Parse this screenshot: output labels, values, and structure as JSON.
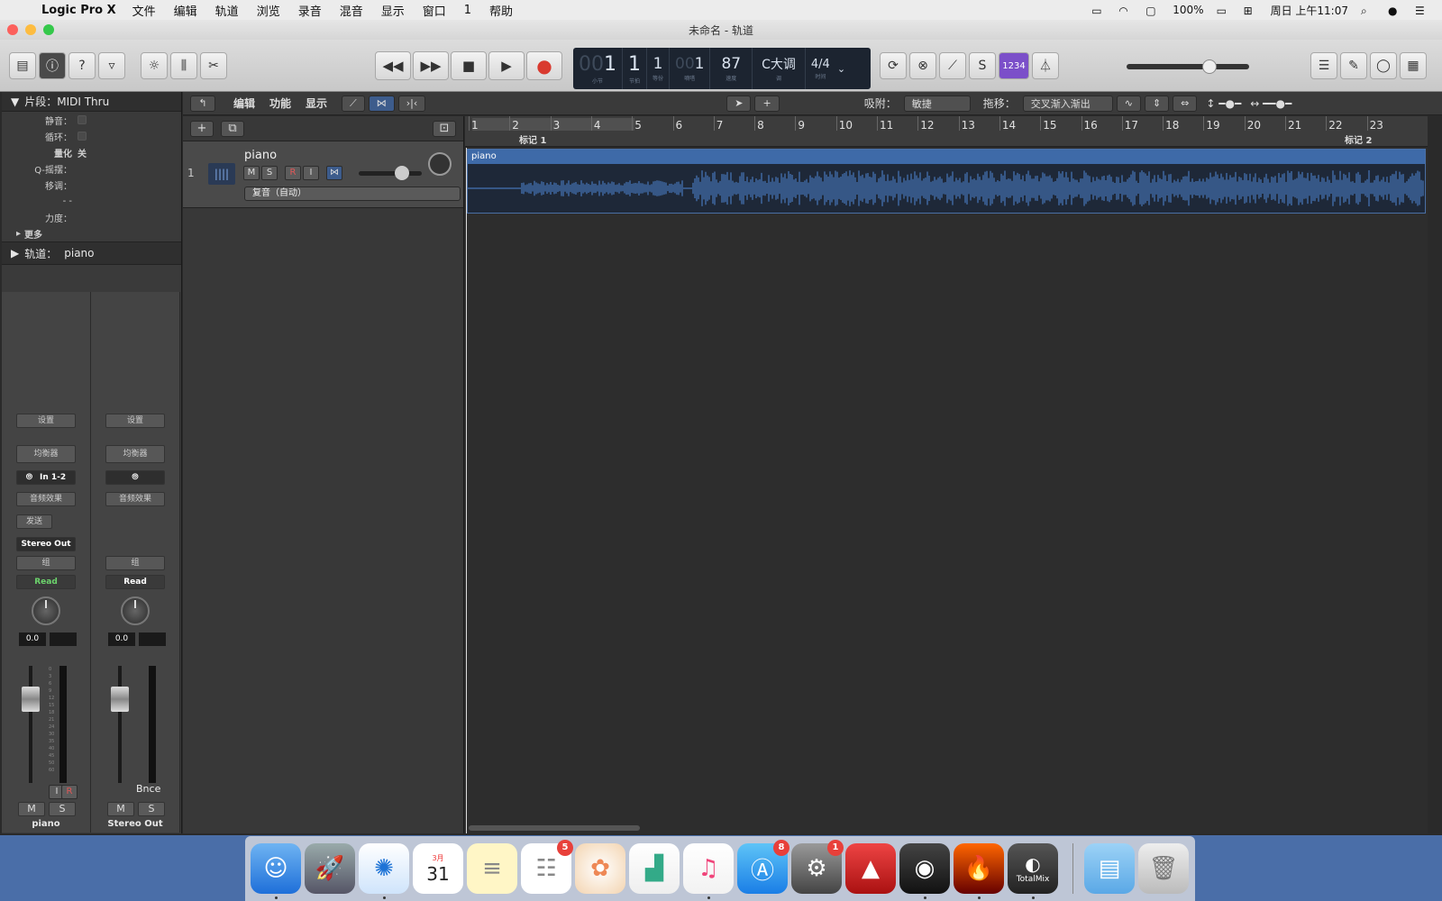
{
  "menubar": {
    "app": "Logic Pro X",
    "items": [
      "文件",
      "编辑",
      "轨道",
      "浏览",
      "录音",
      "混音",
      "显示",
      "窗口",
      "1",
      "帮助"
    ],
    "battery": "100%",
    "clock": "周日 上午11:07"
  },
  "window": {
    "title": "未命名 - 轨道"
  },
  "lcd": {
    "bar": "1",
    "bar_dim": "00",
    "bar_label": "小节",
    "beat": "1",
    "beat_label": "节拍",
    "div": "1",
    "div_label": "等份",
    "tick": "1",
    "tick_dim": "00",
    "tick_label": "嘀嗒",
    "tempo": "87",
    "tempo_label": "速度",
    "key": "C大调",
    "key_label": "调",
    "sig": "4/4",
    "sig_label": "时间"
  },
  "count_in": "1234",
  "inspector": {
    "region_header": "片段：MIDI Thru",
    "rows": [
      {
        "label": "静音：",
        "value": ""
      },
      {
        "label": "循环：",
        "value": ""
      },
      {
        "label": "量化",
        "value": "关"
      },
      {
        "label": "Q-摇摆：",
        "value": ""
      },
      {
        "label": "移调：",
        "value": ""
      },
      {
        "label": "",
        "value": "- -"
      },
      {
        "label": "力度：",
        "value": ""
      }
    ],
    "more": "更多",
    "track_header_label": "轨道：",
    "track_header_name": "piano"
  },
  "strips": [
    {
      "setting": "设置",
      "eq": "均衡器",
      "input": "In 1-2",
      "fx": "音频效果",
      "send": "发送",
      "output": "Stereo Out",
      "group": "组",
      "auto": "Read",
      "vol": "0.0",
      "name": "piano",
      "m": "M",
      "s": "S",
      "i": "I",
      "r": "R"
    },
    {
      "setting": "设置",
      "eq": "均衡器",
      "input": "",
      "fx": "音频效果",
      "send": "",
      "output": "",
      "group": "组",
      "auto": "Read",
      "vol": "0.0",
      "name": "Stereo Out",
      "m": "M",
      "s": "S",
      "bnce": "Bnce"
    }
  ],
  "meter_scale": [
    "0",
    "3",
    "6",
    "9",
    "12",
    "15",
    "18",
    "21",
    "24",
    "",
    "30",
    "35",
    "40",
    "45",
    "50",
    "60"
  ],
  "tracks_header": {
    "edit": "编辑",
    "functions": "功能",
    "view": "显示",
    "snap_label": "吸附：",
    "snap_value": "敏捷",
    "drag_label": "拖移：",
    "drag_value": "交叉渐入渐出"
  },
  "track": {
    "number": "1",
    "name": "piano",
    "m": "M",
    "s": "S",
    "r": "R",
    "i": "I",
    "voice": "复音（自动）"
  },
  "ruler": {
    "bars": [
      "1",
      "2",
      "3",
      "4",
      "5",
      "6",
      "7",
      "8",
      "9",
      "10",
      "11",
      "12",
      "13",
      "14",
      "15",
      "16",
      "17",
      "18",
      "19",
      "20",
      "21",
      "22",
      "23"
    ],
    "marker1": "标记 1",
    "marker2": "标记 2"
  },
  "region": {
    "name": "piano"
  },
  "dock": {
    "calendar_month": "3月",
    "calendar_day": "31",
    "reminders_badge": "5",
    "appstore_badge": "8",
    "prefs_badge": "1",
    "totalmix": "TotalMix"
  },
  "colors": {
    "accent": "#3e6aa8",
    "record": "#d93a2f",
    "count_in": "#7b4fc9"
  }
}
